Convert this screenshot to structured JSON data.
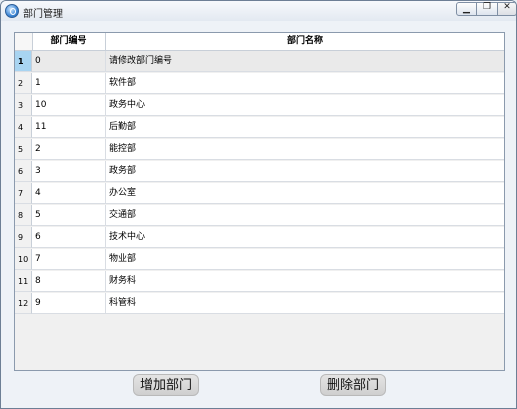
{
  "window": {
    "title": "部门管理"
  },
  "table": {
    "columns": [
      "部门编号",
      "部门名称"
    ],
    "rows": [
      {
        "num": "1",
        "id": "0",
        "name": "请修改部门编号",
        "selected": true
      },
      {
        "num": "2",
        "id": "1",
        "name": "软件部"
      },
      {
        "num": "3",
        "id": "10",
        "name": "政务中心"
      },
      {
        "num": "4",
        "id": "11",
        "name": "后勤部"
      },
      {
        "num": "5",
        "id": "2",
        "name": "能控部"
      },
      {
        "num": "6",
        "id": "3",
        "name": "政务部"
      },
      {
        "num": "7",
        "id": "4",
        "name": "办公室"
      },
      {
        "num": "8",
        "id": "5",
        "name": "交通部"
      },
      {
        "num": "9",
        "id": "6",
        "name": "技术中心"
      },
      {
        "num": "10",
        "id": "7",
        "name": "物业部"
      },
      {
        "num": "11",
        "id": "8",
        "name": "财务科"
      },
      {
        "num": "12",
        "id": "9",
        "name": "科管科"
      }
    ]
  },
  "buttons": {
    "add": "增加部门",
    "delete": "删除部门"
  }
}
